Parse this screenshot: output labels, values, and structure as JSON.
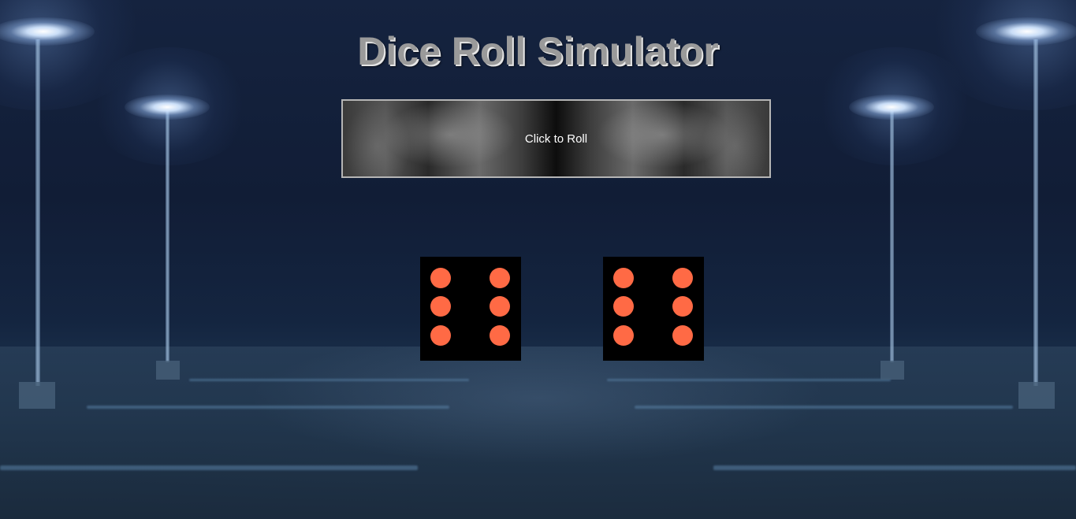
{
  "title": "Dice Roll Simulator",
  "roll_button": {
    "label": "Click to Roll"
  },
  "dice": [
    {
      "value": 6
    },
    {
      "value": 6
    }
  ],
  "colors": {
    "pip": "#ff6a45",
    "die_face": "#000000",
    "title_text": "#9a9a9a"
  }
}
